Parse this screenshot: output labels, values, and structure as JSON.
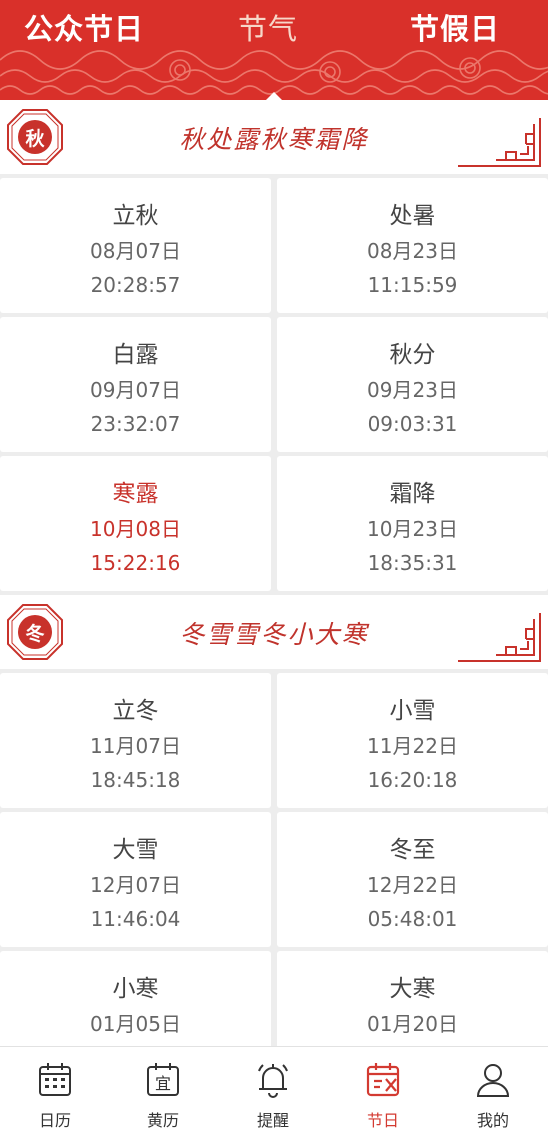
{
  "tabs": {
    "items": [
      {
        "label": "公众节日",
        "active": false
      },
      {
        "label": "节气",
        "active": true
      },
      {
        "label": "节假日",
        "active": false
      }
    ]
  },
  "sections": [
    {
      "badge": "秋",
      "title": "秋处露秋寒霜降",
      "terms": [
        {
          "name": "立秋",
          "date": "08月07日",
          "time": "20:28:57",
          "highlight": false
        },
        {
          "name": "处暑",
          "date": "08月23日",
          "time": "11:15:59",
          "highlight": false
        },
        {
          "name": "白露",
          "date": "09月07日",
          "time": "23:32:07",
          "highlight": false
        },
        {
          "name": "秋分",
          "date": "09月23日",
          "time": "09:03:31",
          "highlight": false
        },
        {
          "name": "寒露",
          "date": "10月08日",
          "time": "15:22:16",
          "highlight": true
        },
        {
          "name": "霜降",
          "date": "10月23日",
          "time": "18:35:31",
          "highlight": false
        }
      ]
    },
    {
      "badge": "冬",
      "title": "冬雪雪冬小大寒",
      "terms": [
        {
          "name": "立冬",
          "date": "11月07日",
          "time": "18:45:18",
          "highlight": false
        },
        {
          "name": "小雪",
          "date": "11月22日",
          "time": "16:20:18",
          "highlight": false
        },
        {
          "name": "大雪",
          "date": "12月07日",
          "time": "11:46:04",
          "highlight": false
        },
        {
          "name": "冬至",
          "date": "12月22日",
          "time": "05:48:01",
          "highlight": false
        },
        {
          "name": "小寒",
          "date": "01月05日",
          "time": "",
          "highlight": false
        },
        {
          "name": "大寒",
          "date": "01月20日",
          "time": "",
          "highlight": false
        }
      ]
    }
  ],
  "bottom_nav": {
    "items": [
      {
        "label": "日历",
        "icon": "calendar-grid-icon",
        "active": false
      },
      {
        "label": "黄历",
        "icon": "almanac-icon",
        "active": false
      },
      {
        "label": "提醒",
        "icon": "bell-icon",
        "active": false
      },
      {
        "label": "节日",
        "icon": "festival-calendar-icon",
        "active": true
      },
      {
        "label": "我的",
        "icon": "user-icon",
        "active": false
      }
    ]
  },
  "colors": {
    "brand_red": "#d9302a",
    "title_red": "#c0332c",
    "highlight_red": "#c8322b",
    "nav_active": "#d33a31"
  }
}
